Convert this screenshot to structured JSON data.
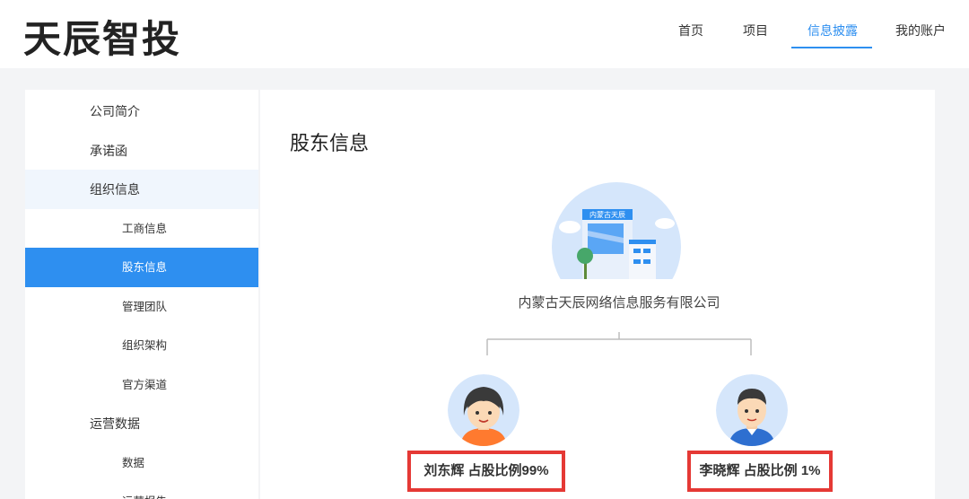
{
  "header": {
    "logo_text": "天辰智投",
    "nav": [
      {
        "label": "首页",
        "active": false
      },
      {
        "label": "项目",
        "active": false
      },
      {
        "label": "信息披露",
        "active": true
      },
      {
        "label": "我的账户",
        "active": false
      }
    ],
    "accent_color": "#2e8ff0"
  },
  "sidebar": {
    "items": [
      {
        "label": "公司简介",
        "level": 1
      },
      {
        "label": "承诺函",
        "level": 1
      },
      {
        "label": "组织信息",
        "level": 1,
        "expanded": true
      },
      {
        "label": "工商信息",
        "level": 2
      },
      {
        "label": "股东信息",
        "level": 2,
        "active": true
      },
      {
        "label": "管理团队",
        "level": 2
      },
      {
        "label": "组织架构",
        "level": 2
      },
      {
        "label": "官方渠道",
        "level": 2
      },
      {
        "label": "运营数据",
        "level": 1
      },
      {
        "label": "数据",
        "level": 2
      },
      {
        "label": "运营报告",
        "level": 2
      }
    ]
  },
  "main": {
    "title": "股东信息",
    "company": {
      "logo_sign": "内蒙古天辰",
      "name": "内蒙古天辰网络信息服务有限公司"
    },
    "shareholders": [
      {
        "name": "刘东辉",
        "label": "刘东辉 占股比例99%",
        "avatar": "female-avatar-icon"
      },
      {
        "name": "李晓辉",
        "label": "李晓辉 占股比例 1%",
        "avatar": "male-avatar-icon"
      }
    ],
    "highlight_color": "#e53935"
  }
}
